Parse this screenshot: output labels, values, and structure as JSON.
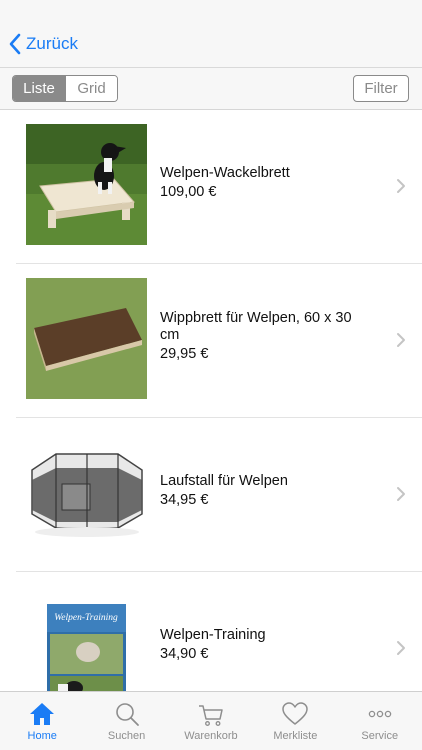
{
  "navbar": {
    "back_label": "Zurück"
  },
  "toolbar": {
    "segments": [
      "Liste",
      "Grid"
    ],
    "active_segment": "Liste",
    "filter_label": "Filter"
  },
  "products": [
    {
      "name": "Welpen-Wackelbrett",
      "price": "109,00 €",
      "image": "dog-on-wobble-board"
    },
    {
      "name": "Wippbrett für Welpen, 60 x 30 cm",
      "price": "29,95 €",
      "image": "seesaw-board-on-grass"
    },
    {
      "name": "Laufstall für Welpen",
      "price": "34,95 €",
      "image": "puppy-playpen"
    },
    {
      "name": "Welpen-Training",
      "price": "34,90 €",
      "image": "book-cover"
    }
  ],
  "book_cover_title": "Welpen-Training",
  "tabs": [
    {
      "label": "Home",
      "icon": "home-icon",
      "active": true
    },
    {
      "label": "Suchen",
      "icon": "search-icon",
      "active": false
    },
    {
      "label": "Warenkorb",
      "icon": "cart-icon",
      "active": false
    },
    {
      "label": "Merkliste",
      "icon": "heart-icon",
      "active": false
    },
    {
      "label": "Service",
      "icon": "more-icon",
      "active": false
    }
  ],
  "colors": {
    "accent": "#1a7cf5",
    "inactive": "#8e8e8e",
    "segment": "#8a8a8a"
  }
}
